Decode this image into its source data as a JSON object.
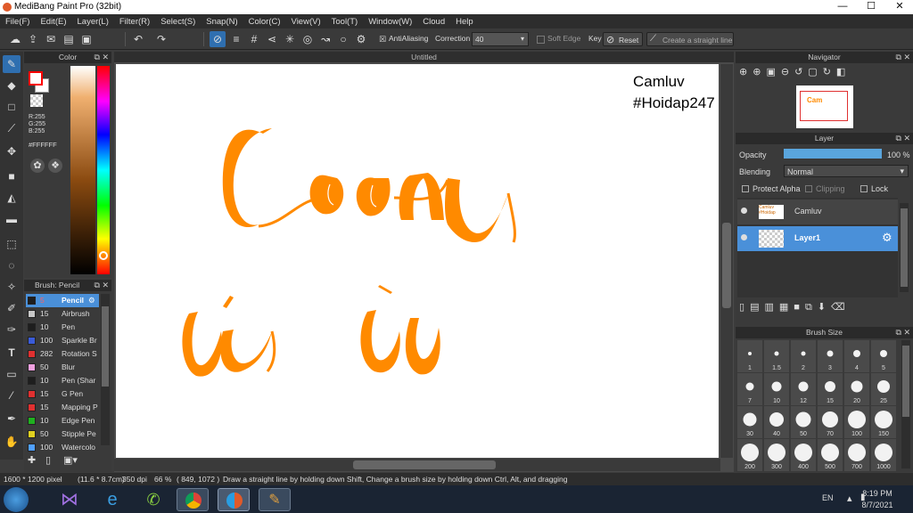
{
  "window": {
    "title": "MediBang Paint Pro (32bit)",
    "minimize": "—",
    "maximize": "☐",
    "close": "✕"
  },
  "menu": [
    "File(F)",
    "Edit(E)",
    "Layer(L)",
    "Filter(R)",
    "Select(S)",
    "Snap(N)",
    "Color(C)",
    "View(V)",
    "Tool(T)",
    "Window(W)",
    "Cloud",
    "Help"
  ],
  "toolbar": {
    "antialiasing": "AntiAliasing",
    "correction_label": "Correction",
    "correction_value": "40",
    "soft_edge": "Soft Edge",
    "key_label": "Key",
    "reset": "Reset",
    "straight_line": "Create a straight line"
  },
  "color_panel": {
    "title": "Color",
    "r": "R:255",
    "g": "G:255",
    "b": "B:255",
    "hex": "#FFFFFF",
    "fg_color": "#ff0000",
    "bg_color": "#ffffff"
  },
  "brush_panel": {
    "title": "Brush: Pencil",
    "items": [
      {
        "size": "5",
        "name": "Pencil",
        "color": "#1e1e1e",
        "selected": true
      },
      {
        "size": "15",
        "name": "Airbrush",
        "color": "#c8c8c8"
      },
      {
        "size": "10",
        "name": "Pen",
        "color": "#1e1e1e"
      },
      {
        "size": "100",
        "name": "Sparkle Br",
        "color": "#3a5bd8"
      },
      {
        "size": "282",
        "name": "Rotation S",
        "color": "#e03030"
      },
      {
        "size": "50",
        "name": "Blur",
        "color": "#f0a0e0"
      },
      {
        "size": "10",
        "name": "Pen (Shar",
        "color": "#1e1e1e"
      },
      {
        "size": "15",
        "name": "G Pen",
        "color": "#e03030"
      },
      {
        "size": "15",
        "name": "Mapping P",
        "color": "#e03030"
      },
      {
        "size": "10",
        "name": "Edge Pen",
        "color": "#20b020"
      },
      {
        "size": "50",
        "name": "Stipple Pe",
        "color": "#e0d020"
      },
      {
        "size": "100",
        "name": "Watercolo",
        "color": "#50a0ff"
      }
    ]
  },
  "document": {
    "tab": "Untitled"
  },
  "canvas_text": {
    "line1": "Camluv",
    "line2": "#Hoidap247"
  },
  "navigator": {
    "title": "Navigator"
  },
  "layer_panel": {
    "title": "Layer",
    "opacity_label": "Opacity",
    "opacity_value": "100 %",
    "opacity_fraction": 1.0,
    "blending_label": "Blending",
    "blending_value": "Normal",
    "protect_alpha": "Protect Alpha",
    "clipping": "Clipping",
    "lock": "Lock",
    "layers": [
      {
        "name": "Camluv",
        "selected": false
      },
      {
        "name": "Layer1",
        "selected": true
      }
    ]
  },
  "brush_size_panel": {
    "title": "Brush Size",
    "sizes": [
      "1",
      "1.5",
      "2",
      "3",
      "4",
      "5",
      "7",
      "10",
      "12",
      "15",
      "20",
      "25",
      "30",
      "40",
      "50",
      "70",
      "100",
      "150",
      "200",
      "300",
      "400",
      "500",
      "700",
      "1000"
    ]
  },
  "status": {
    "pixels": "1600 * 1200 pixel",
    "cm": "(11.6 * 8.7cm)",
    "dpi": "350 dpi",
    "zoom": "66 %",
    "coords": "( 849, 1072 )",
    "hint": "Draw a straight line by holding down Shift, Change a brush size by holding down Ctrl, Alt, and dragging"
  },
  "taskbar": {
    "lang": "EN",
    "time": "8:19 PM",
    "date": "8/7/2021"
  },
  "colors": {
    "accent": "#4a90d9",
    "drawing": "#ff8a00"
  }
}
